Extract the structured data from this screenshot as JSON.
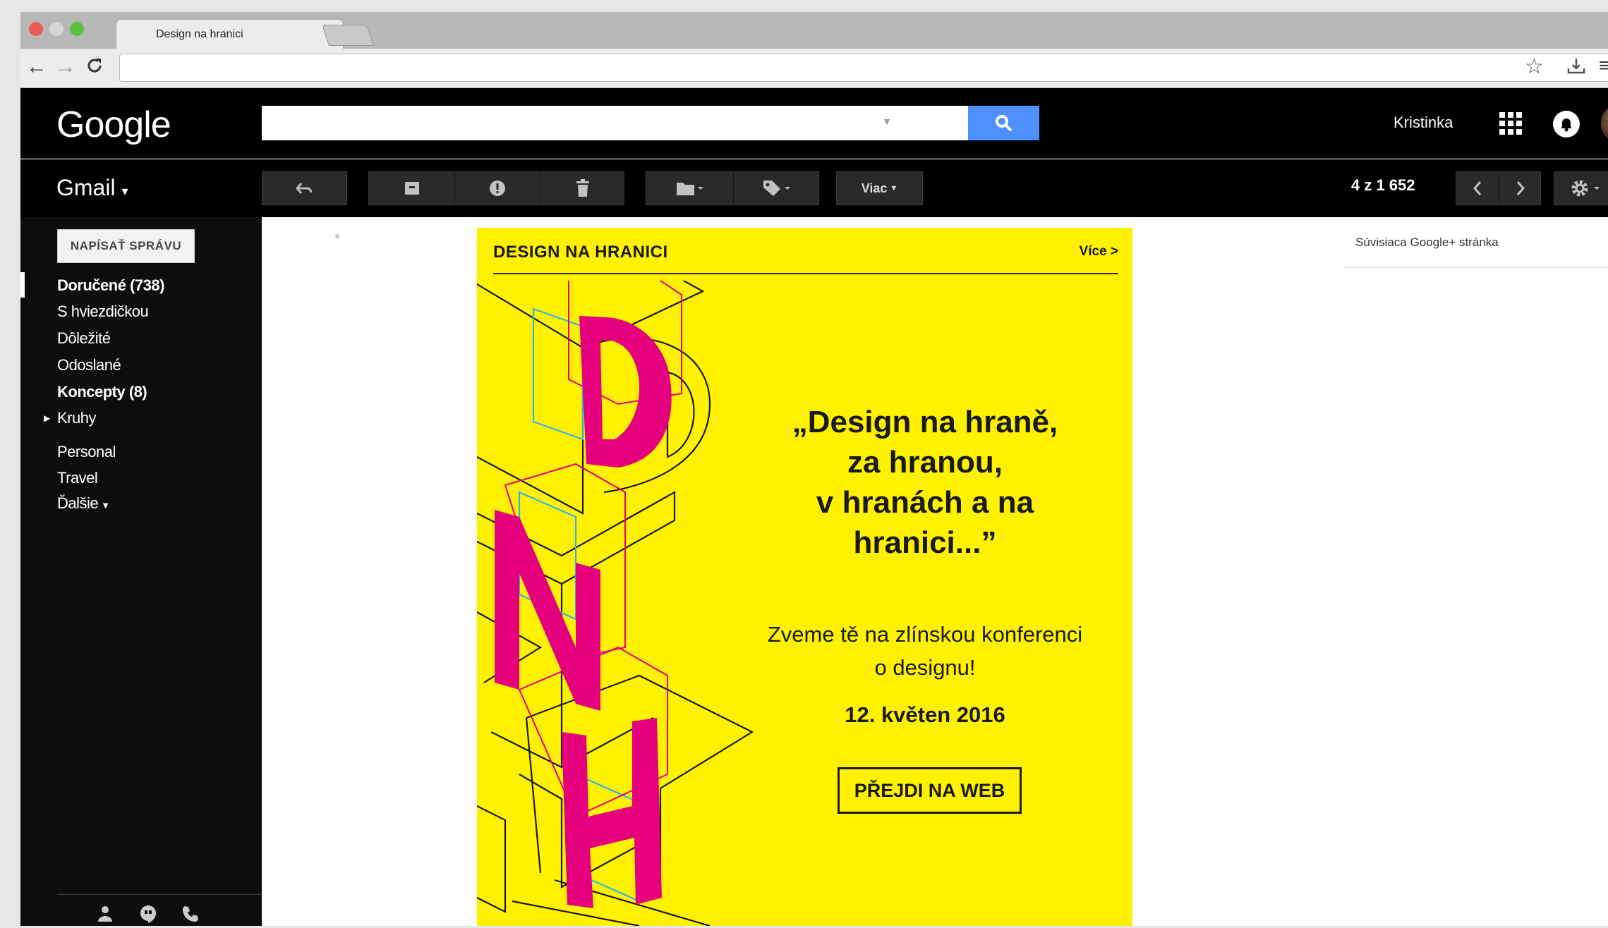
{
  "browser": {
    "tab_title": "Design na hranici",
    "tab_close": "×"
  },
  "gmail": {
    "logo": "Google",
    "label": "Gmail",
    "label_caret": "▾",
    "user_name": "Kristinka",
    "toolbar": {
      "more": "Viac",
      "count": "4 z 1 652"
    }
  },
  "sidebar": {
    "compose": "NAPÍSAŤ SPRÁVU",
    "items": [
      {
        "label": "Doručené (738)",
        "bold": true
      },
      {
        "label": "S hviezdičkou",
        "bold": false
      },
      {
        "label": "Dôležité",
        "bold": false
      },
      {
        "label": "Odoslané",
        "bold": false
      },
      {
        "label": "Koncepty (8)",
        "bold": true
      },
      {
        "label": "Kruhy",
        "bold": false
      },
      {
        "label": "Personal",
        "bold": false
      },
      {
        "label": "Travel",
        "bold": false
      },
      {
        "label": "Ďalšie",
        "bold": false
      }
    ]
  },
  "right_panel": {
    "related": "Súvisiaca Google+ stránka"
  },
  "newsletter": {
    "header": "DESIGN NA HRANICI",
    "more_link": "Více >",
    "quote_lines": [
      "„Design na hraně,",
      "za hranou,",
      "v hranách a na",
      "hranici...”"
    ],
    "invite_lines": [
      "Zveme tě na zlínskou konferenci",
      "o designu!"
    ],
    "date": "12. květen 2016",
    "cta": "PŘEJDI NA WEB",
    "letters": [
      "D",
      "N",
      "H"
    ],
    "colors": {
      "background": "#fff100",
      "magenta": "#e5007e",
      "cyan": "#2fb4e9",
      "ink": "#1a1a1a"
    }
  },
  "icons": {
    "back": "←",
    "forward": "→",
    "reload": "C",
    "star": "☆",
    "menu": "≡"
  }
}
